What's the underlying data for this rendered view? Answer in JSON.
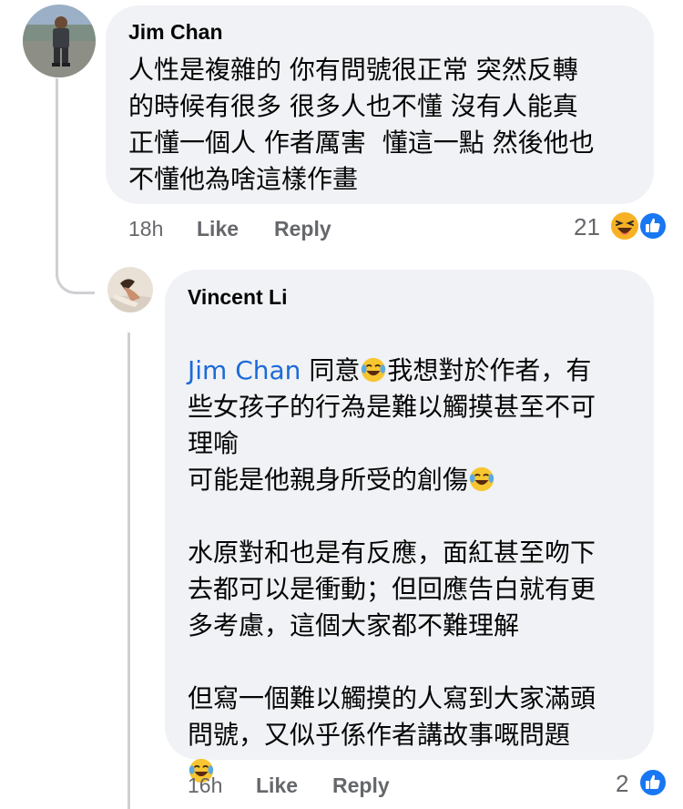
{
  "comment": {
    "author": "Jim Chan",
    "text": "人性是複雜的 你有問號很正常 突然反轉\n的時候有很多 很多人也不懂 沒有人能真\n正懂一個人 作者厲害  懂這一點 然後他也\n不懂他為啥這樣作畫",
    "time": "18h",
    "like_label": "Like",
    "reply_label": "Reply",
    "reaction_count": "21",
    "reactions": [
      "haha-icon",
      "like-icon"
    ]
  },
  "reply": {
    "author": "Vincent Li",
    "mention": "Jim Chan",
    "text_line1_a": " 同意",
    "text_line1_b": "我想對於作者，有",
    "text_rest1": "些女孩子的行為是難以觸摸甚至不可\n理喻\n可能是他親身所受的創傷",
    "text_rest2": "\n\n水原對和也是有反應，面紅甚至吻下\n去都可以是衝動；但回應告白就有更\n多考慮，這個大家都不難理解\n\n但寫一個難以觸摸的人寫到大家滿頭\n問號，又似乎係作者講故事嘅問題\n",
    "time": "16h",
    "like_label": "Like",
    "reply_label": "Reply",
    "reaction_count": "2",
    "reactions": [
      "like-icon"
    ],
    "inline_emoji": "laugh-cry-emoji"
  },
  "colors": {
    "bubble": "#f0f2f5",
    "meta": "#65676b",
    "mention": "#1c6ad8",
    "like_blue": "#1877f2",
    "thread_line": "#ced0d4"
  }
}
